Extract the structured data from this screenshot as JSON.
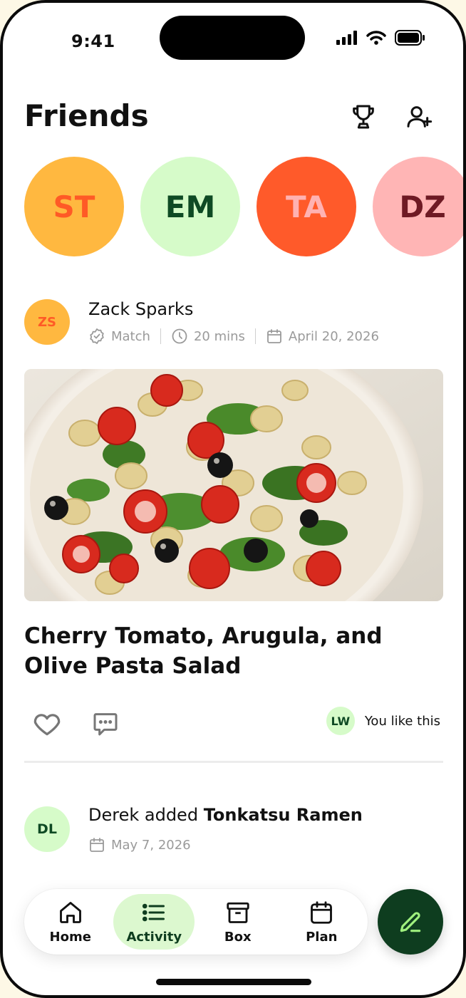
{
  "status": {
    "time": "9:41"
  },
  "header": {
    "title": "Friends",
    "trophy_icon": "trophy-icon",
    "add_friend_icon": "user-plus-icon"
  },
  "friends": [
    {
      "initials": "ST",
      "bg": "#FFB840",
      "fg": "#FF5A26"
    },
    {
      "initials": "EM",
      "bg": "#D6FBC9",
      "fg": "#0F4A24"
    },
    {
      "initials": "TA",
      "bg": "#FF5A2A",
      "fg": "#FFB2B2"
    },
    {
      "initials": "DZ",
      "bg": "#FFB5B5",
      "fg": "#6E1A24"
    }
  ],
  "post": {
    "author": {
      "initials": "ZS",
      "name": "Zack Sparks",
      "bg": "#FFB840",
      "fg": "#FF5A26"
    },
    "meta": {
      "type": "Match",
      "duration": "20 mins",
      "date": "April 20, 2026"
    },
    "recipe_title": "Cherry Tomato, Arugula, and Olive Pasta Salad",
    "likes": {
      "initials": "LW",
      "text": "You like this",
      "bg": "#D6FBC9",
      "fg": "#0F4A24"
    }
  },
  "activity2": {
    "initials": "DL",
    "bg": "#D6FBC9",
    "fg": "#0F4A24",
    "prefix": "Derek added ",
    "recipe": "Tonkatsu Ramen",
    "date": "May 7, 2026"
  },
  "tabs": [
    {
      "label": "Home",
      "icon": "home-icon",
      "active": false
    },
    {
      "label": "Activity",
      "icon": "list-icon",
      "active": true
    },
    {
      "label": "Box",
      "icon": "archive-box-icon",
      "active": false
    },
    {
      "label": "Plan",
      "icon": "calendar-icon",
      "active": false
    }
  ],
  "fab": {
    "icon": "pencil-icon"
  },
  "colors": {
    "brand_dark": "#0E3D1F",
    "active_tab": "#DCF8CF",
    "muted": "#9A9A9A"
  }
}
